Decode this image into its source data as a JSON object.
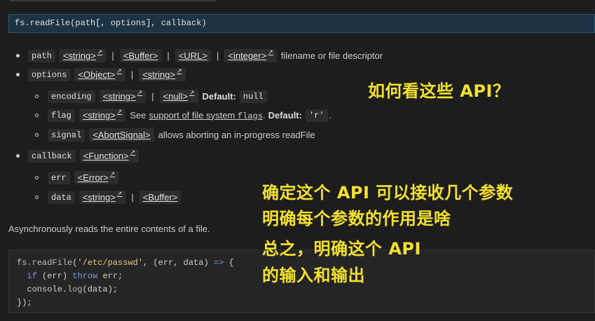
{
  "signature": "fs.readFile(path[, options], callback)",
  "params": {
    "path": {
      "name": "path",
      "types": [
        "<string>",
        "<Buffer>",
        "<URL>",
        "<integer>"
      ],
      "desc": "filename or file descriptor"
    },
    "options": {
      "name": "options",
      "types": [
        "<Object>",
        "<string>"
      ],
      "encoding": {
        "name": "encoding",
        "types": [
          "<string>",
          "<null>"
        ],
        "default_label": "Default:",
        "default_value": "null"
      },
      "flag": {
        "name": "flag",
        "type": "<string>",
        "see": "See",
        "link": "support of file system",
        "link_code": "flags",
        "period": ".",
        "default_label": "Default:",
        "default_value": "'r'",
        "end": "."
      },
      "signal": {
        "name": "signal",
        "type": "<AbortSignal>",
        "desc": "allows aborting an in-progress readFile"
      }
    },
    "callback": {
      "name": "callback",
      "type": "<Function>",
      "err": {
        "name": "err",
        "type": "<Error>"
      },
      "data": {
        "name": "data",
        "types": [
          "<string>",
          "<Buffer>"
        ]
      }
    }
  },
  "pipe": "|",
  "description": "Asynchronously reads the entire contents of a file.",
  "code": {
    "l1_fn": "fs.",
    "l1_call": "readFile",
    "l1_open": "(",
    "l1_str": "'/etc/passwd'",
    "l1_rest": ", (err, data) ",
    "l1_arrow": "=>",
    "l1_brace": " {",
    "l2_if": "if",
    "l2_cond": " (err) ",
    "l2_throw": "throw",
    "l2_rest": " err;",
    "l3_obj": "console.",
    "l3_log": "log",
    "l3_rest": "(data);",
    "l4": "});"
  },
  "annotations": {
    "question": "如何看这些 API？",
    "line1": "确定这个 API 可以接收几个参数",
    "line2": "明确每个参数的作用是啥",
    "line3": "总之，明确这个 API",
    "line4": "的输入和输出"
  },
  "icons": {
    "external_link": "external-link-icon"
  },
  "colors": {
    "annotation": "#f2e12e",
    "signature_bg": "#1b3345",
    "code_keyword": "#6ca0dc",
    "code_string": "#e4c98a"
  }
}
